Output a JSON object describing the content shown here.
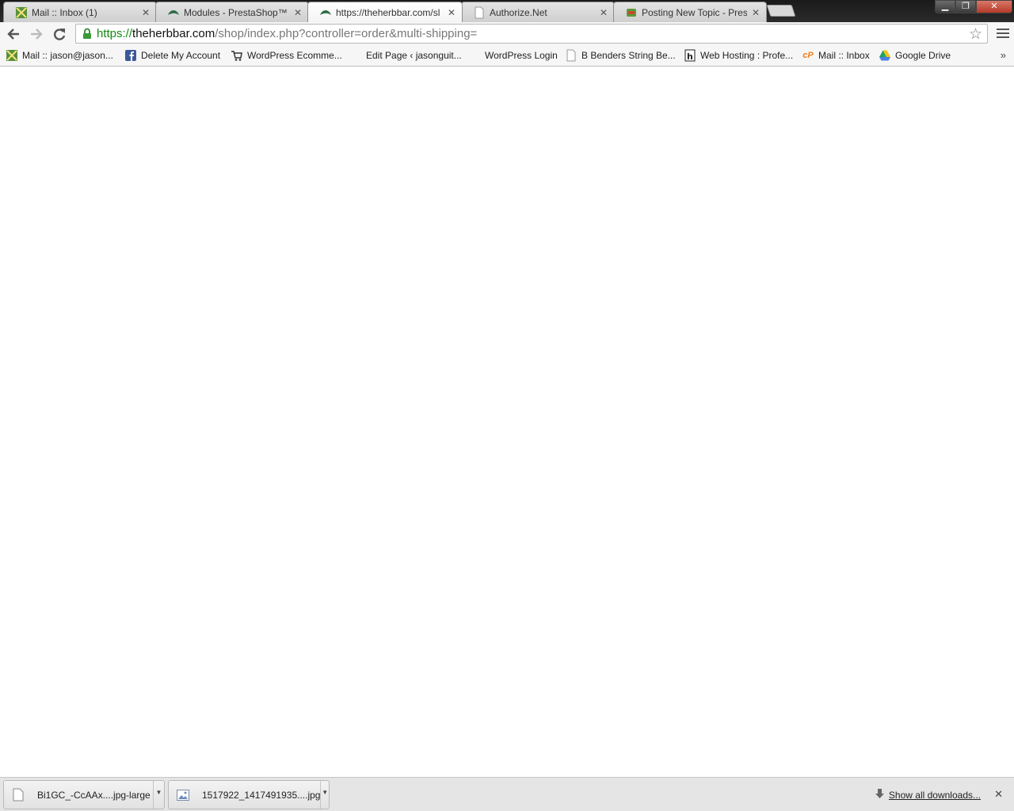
{
  "tabs": [
    {
      "title": "Mail :: Inbox (1)",
      "icon": "mail-icon",
      "active": false
    },
    {
      "title": "Modules - PrestaShop™",
      "icon": "prestashop-icon",
      "active": false
    },
    {
      "title": "https://theherbbar.com/sl",
      "icon": "prestashop-icon",
      "active": true
    },
    {
      "title": "Authorize.Net",
      "icon": "page-icon",
      "active": false
    },
    {
      "title": "Posting New Topic - Prest",
      "icon": "forum-icon",
      "active": false
    }
  ],
  "toolbar": {
    "url_scheme": "https://",
    "url_host": "theherbbar.com",
    "url_path": "/shop/index.php?controller=order&multi-shipping="
  },
  "bookmarks": [
    {
      "label": "Mail :: jason@jason...",
      "icon": "mail-icon"
    },
    {
      "label": "Delete My Account",
      "icon": "facebook-icon"
    },
    {
      "label": "WordPress Ecomme...",
      "icon": "cart-icon"
    },
    {
      "label": "Edit Page ‹ jasonguit...",
      "icon": "blank-icon"
    },
    {
      "label": "WordPress Login",
      "icon": "blank-icon"
    },
    {
      "label": "B Benders String Be...",
      "icon": "page-icon"
    },
    {
      "label": "Web Hosting : Profe...",
      "icon": "hosting-icon"
    },
    {
      "label": "Mail :: Inbox",
      "icon": "cpanel-icon"
    },
    {
      "label": "Google Drive",
      "icon": "google-drive-icon"
    }
  ],
  "downloads": [
    {
      "name": "Bi1GC_-CcAAx....jpg-large",
      "icon": "file-icon"
    },
    {
      "name": "1517922_1417491935....jpg",
      "icon": "image-file-icon"
    }
  ],
  "shelf": {
    "show_all": "Show all downloads..."
  }
}
